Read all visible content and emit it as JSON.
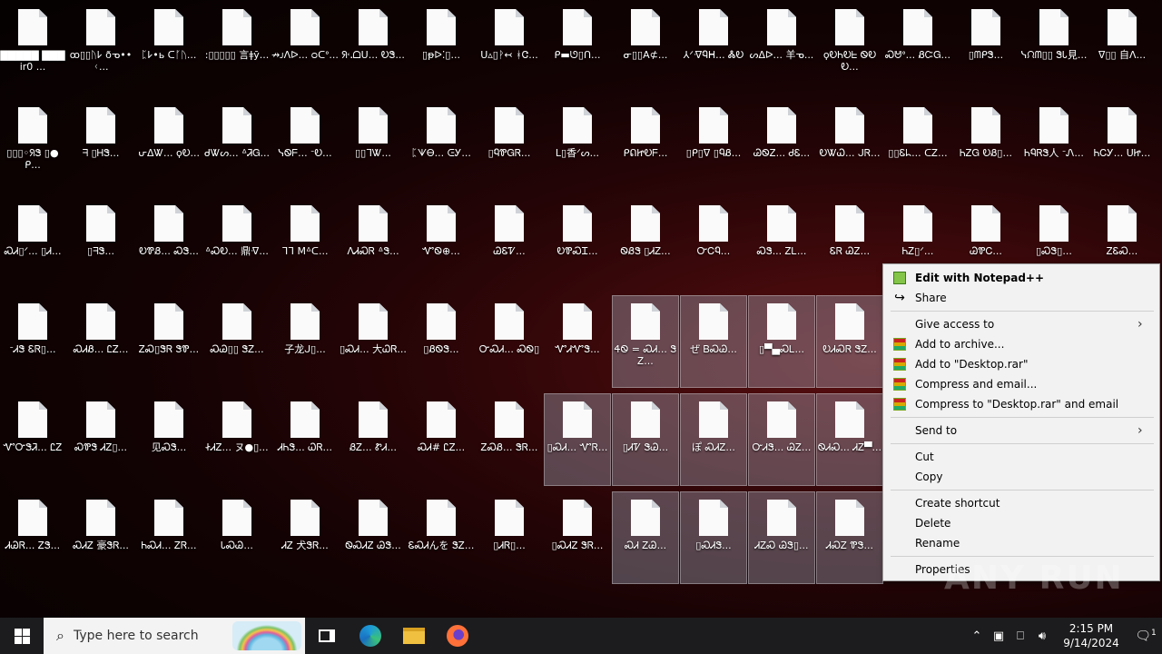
{
  "desktop": {
    "icons": [
      {
        "label": "▇▇▇▇▇ ▇▇▇ ir0 ...",
        "col": 0,
        "row": 0,
        "selected": false
      },
      {
        "label": "ꝏ▯▯ᚢ𐌋 ðᓀ••ᚲ...",
        "col": 1,
        "row": 0,
        "selected": false
      },
      {
        "label": "ᛈ𐌋•ь ᑕᚪᚢ...",
        "col": 2,
        "row": 0,
        "selected": false
      },
      {
        "label": ":▯▯▯▯▯ 言ǂȳ...",
        "col": 3,
        "row": 0,
        "selected": false
      },
      {
        "label": "↛ᴊᐱᐅ... ᴑᑕᐤ...",
        "col": 4,
        "row": 0,
        "selected": false
      },
      {
        "label": "ᖆ˓᎐ᗝᑌ... ᎧᏕ...",
        "col": 5,
        "row": 0,
        "selected": false
      },
      {
        "label": "▯ᵽᐅ⁚▯...",
        "col": 6,
        "row": 0,
        "selected": false
      },
      {
        "label": "ᑌ▵▯ᚹ↢ ᚼᏣ...",
        "col": 7,
        "row": 0,
        "selected": false
      },
      {
        "label": "ᑭ▬ᘎ▯ᑎ...",
        "col": 8,
        "row": 0,
        "selected": false
      },
      {
        "label": "ᓂ▯▯A⊄...",
        "col": 9,
        "row": 0,
        "selected": false
      },
      {
        "label": "⅄ᐟᐌᏄᕼ... ᏜᎧ",
        "col": 10,
        "row": 0,
        "selected": false
      },
      {
        "label": "ᔕᐃᐅ... 羊ᓀ...",
        "col": 11,
        "row": 0,
        "selected": false
      },
      {
        "label": "ϙᎧᏂᎧᖶ ᏫᎧᎧ...",
        "col": 12,
        "row": 0,
        "selected": false
      },
      {
        "label": "Ꮝᕰᐤ... ᏰᏨᏀ...",
        "col": 13,
        "row": 0,
        "selected": false
      },
      {
        "label": "▯ᗰᑭᏕ...",
        "col": 14,
        "row": 0,
        "selected": false
      },
      {
        "label": "ᓭᙁᗰ▯▯ ᏕᏓ見...",
        "col": 15,
        "row": 0,
        "selected": false
      },
      {
        "label": "ᐁ▯▯ 自ᐱ...",
        "col": 16,
        "row": 0,
        "selected": false
      },
      {
        "label": "▯▯▯◦ᖆᏕ ▯●ᑭ...",
        "col": 0,
        "row": 1,
        "selected": false
      },
      {
        "label": "ᖷ ▯ᎻᏕ...",
        "col": 1,
        "row": 1,
        "selected": false
      },
      {
        "label": "ᕂᐃᏔ... ϙᎧ...",
        "col": 2,
        "row": 1,
        "selected": false
      },
      {
        "label": "ᑯᏔᔕ... ᐞᏘᏀ...",
        "col": 3,
        "row": 1,
        "selected": false
      },
      {
        "label": "ᓭᏫᖴ... ᐨᎧ...",
        "col": 4,
        "row": 1,
        "selected": false
      },
      {
        "label": "▯▯ᒣᏔ...",
        "col": 5,
        "row": 1,
        "selected": false
      },
      {
        "label": "ᛈᗐᎾ... ᕮᎩ...",
        "col": 6,
        "row": 1,
        "selected": false
      },
      {
        "label": "▯ᏄᏈᏀᏒ...",
        "col": 7,
        "row": 1,
        "selected": false
      },
      {
        "label": "ᒪ▯香ᐟᔕ...",
        "col": 8,
        "row": 1,
        "selected": false
      },
      {
        "label": "ᑭᕠᏥᎧᖴ...",
        "col": 9,
        "row": 1,
        "selected": false
      },
      {
        "label": "▯ᑭ▯ᐁ ▯ᏄᏰ...",
        "col": 10,
        "row": 1,
        "selected": false
      },
      {
        "label": "ᏊᏫᏃ... ᏧᏋ...",
        "col": 11,
        "row": 1,
        "selected": false
      },
      {
        "label": "ᎧᏔᏇ... ᒍᏒ...",
        "col": 12,
        "row": 1,
        "selected": false
      },
      {
        "label": "▯▯Ꮛᖺ... ᑕᏃ...",
        "col": 13,
        "row": 1,
        "selected": false
      },
      {
        "label": "ᏂᏃᏀ ᎧᏰ▯...",
        "col": 14,
        "row": 1,
        "selected": false
      },
      {
        "label": "ᏂᏄᏒᏕ人 ᐨᏁ...",
        "col": 15,
        "row": 1,
        "selected": false
      },
      {
        "label": "ᏂᏟᎩ... ᑌᏥ...",
        "col": 16,
        "row": 1,
        "selected": false
      },
      {
        "label": "ᏍᏗ▯ᐟ... ▯Ꮧ...",
        "col": 0,
        "row": 2,
        "selected": false
      },
      {
        "label": "▯ᖷᏕ...",
        "col": 1,
        "row": 2,
        "selected": false
      },
      {
        "label": "ᎧᏈᏰ... ᏍᏕ...",
        "col": 2,
        "row": 2,
        "selected": false
      },
      {
        "label": "ᐞᏍᎧ... 鼎ᐌ...",
        "col": 3,
        "row": 2,
        "selected": false
      },
      {
        "label": "ᒣᒣ Mᐞᑕ...",
        "col": 4,
        "row": 2,
        "selected": false
      },
      {
        "label": "ᐱᏗᏍᏒ ᐞᏕ...",
        "col": 5,
        "row": 2,
        "selected": false
      },
      {
        "label": "ᏉᏫ⊕...",
        "col": 6,
        "row": 2,
        "selected": false
      },
      {
        "label": "ᏊᏋᏤ...",
        "col": 7,
        "row": 2,
        "selected": false
      },
      {
        "label": "ᎧᏈᏍᏆ...",
        "col": 8,
        "row": 2,
        "selected": false
      },
      {
        "label": "ᏫᏰᏕ ▯ᏗᏃ...",
        "col": 9,
        "row": 2,
        "selected": false
      },
      {
        "label": "ᏅᏟᏄ...",
        "col": 10,
        "row": 2,
        "selected": false
      },
      {
        "label": "ᏍᏕ... ᏃᏞ...",
        "col": 11,
        "row": 2,
        "selected": false
      },
      {
        "label": "ᏋᏒ ᏊᏃ...",
        "col": 12,
        "row": 2,
        "selected": false
      },
      {
        "label": "ᏂᏃ▯ᐟ...",
        "col": 13,
        "row": 2,
        "selected": false
      },
      {
        "label": "ᏊᏈᏟ...",
        "col": 14,
        "row": 2,
        "selected": false
      },
      {
        "label": "▯ᏍᏕ▯...",
        "col": 15,
        "row": 2,
        "selected": false
      },
      {
        "label": "ᏃᏋᏍ...",
        "col": 16,
        "row": 2,
        "selected": false
      },
      {
        "label": "ᐨᏗᏕ ᏋᏒ▯...",
        "col": 0,
        "row": 3,
        "selected": false
      },
      {
        "label": "ᏍᏗᏰ... ᏝᏃ...",
        "col": 1,
        "row": 3,
        "selected": false
      },
      {
        "label": "ᏃᏍ▯ᏕᏒ ᏕᏈ...",
        "col": 2,
        "row": 3,
        "selected": false
      },
      {
        "label": "ᏍᏊ▯▯ ᏕᏃ...",
        "col": 3,
        "row": 3,
        "selected": false
      },
      {
        "label": "子龙ᒍ▯...",
        "col": 4,
        "row": 3,
        "selected": false
      },
      {
        "label": "▯ᏍᏗ... 大ᏇᏒ...",
        "col": 5,
        "row": 3,
        "selected": false
      },
      {
        "label": "▯ᏰᏫᏕ...",
        "col": 6,
        "row": 3,
        "selected": false
      },
      {
        "label": "ᏅᏍᏗ... ᏍᏫ▯",
        "col": 7,
        "row": 3,
        "selected": false
      },
      {
        "label": "ᏉᏗᏉᏕ...",
        "col": 8,
        "row": 3,
        "selected": false
      },
      {
        "label": "ᏎᏫ = ᏍᏗ... ᏕᏃ...",
        "col": 9,
        "row": 3,
        "selected": true
      },
      {
        "label": "ぜ ᏴᏍᏊ...",
        "col": 10,
        "row": 3,
        "selected": true
      },
      {
        "label": "▯▀▄ᏍᏞ...",
        "col": 11,
        "row": 3,
        "selected": true
      },
      {
        "label": "ᎧᏗᏍᏒ ᏕᏃ...",
        "col": 12,
        "row": 3,
        "selected": true
      },
      {
        "label": "ᏉᏅᏕᏘ... ᏝᏃ",
        "col": 0,
        "row": 4,
        "selected": false
      },
      {
        "label": "ᏍᏈᏕ ᏗᏃ▯...",
        "col": 1,
        "row": 4,
        "selected": false
      },
      {
        "label": "见ᏍᏕ...",
        "col": 2,
        "row": 4,
        "selected": false
      },
      {
        "label": "ᏐᏗᏃ... ヌ●▯...",
        "col": 3,
        "row": 4,
        "selected": false
      },
      {
        "label": "ᏗᏂᏕ... ᏇᏒ...",
        "col": 4,
        "row": 4,
        "selected": false
      },
      {
        "label": "ᏰᏃ... ᏑᏗ...",
        "col": 5,
        "row": 4,
        "selected": false
      },
      {
        "label": "ᏍᏗ# ᏝᏃ...",
        "col": 6,
        "row": 4,
        "selected": false
      },
      {
        "label": "ᏃᏍᏰ... ᏕᏒ...",
        "col": 7,
        "row": 4,
        "selected": false
      },
      {
        "label": "▯ᏍᏗ... ᏉᏒ...",
        "col": 8,
        "row": 4,
        "selected": true
      },
      {
        "label": "▯ᏗᏤ ᏕᏊ...",
        "col": 9,
        "row": 4,
        "selected": true
      },
      {
        "label": "ぽ ᏍᏗᏃ...",
        "col": 10,
        "row": 4,
        "selected": true
      },
      {
        "label": "ᏅᏗᏕ... ᏊᏃ...",
        "col": 11,
        "row": 4,
        "selected": true
      },
      {
        "label": "ᏫᏗᏍ... ᏗᏃ▀...",
        "col": 12,
        "row": 4,
        "selected": true
      },
      {
        "label": "ᏗᏊᏒ... ᏃᏕ...",
        "col": 0,
        "row": 5,
        "selected": false
      },
      {
        "label": "ᏍᏗᏃ 豪ᏕᏒ...",
        "col": 1,
        "row": 5,
        "selected": false
      },
      {
        "label": "ᏂᏍᏗ... ᏃᏒ...",
        "col": 2,
        "row": 5,
        "selected": false
      },
      {
        "label": "ᏓᏍᏊ...",
        "col": 3,
        "row": 5,
        "selected": false
      },
      {
        "label": "ᏗᏃ 犬ᏕᏒ...",
        "col": 4,
        "row": 5,
        "selected": false
      },
      {
        "label": "ᏫᏍᏗᏃ ᏊᏕ...",
        "col": 5,
        "row": 5,
        "selected": false
      },
      {
        "label": "ᏋᏍᏗんを ᏕᏃ...",
        "col": 6,
        "row": 5,
        "selected": false
      },
      {
        "label": "▯ᏗᏒ▯...",
        "col": 7,
        "row": 5,
        "selected": false
      },
      {
        "label": "▯ᏍᏗᏃ ᏕᏒ...",
        "col": 8,
        "row": 5,
        "selected": false
      },
      {
        "label": "ᏍᏗ ᏃᏊ...",
        "col": 9,
        "row": 5,
        "selected": true
      },
      {
        "label": "▯ᏍᏗᏕ...",
        "col": 10,
        "row": 5,
        "selected": true
      },
      {
        "label": "ᏗᏃᏍ ᏊᏕ▯...",
        "col": 11,
        "row": 5,
        "selected": true
      },
      {
        "label": "ᏗᏍᏃ ᏈᏕ...",
        "col": 12,
        "row": 5,
        "selected": true
      }
    ]
  },
  "context_menu": {
    "items": [
      {
        "type": "item",
        "label": "Edit with Notepad++",
        "icon": "notepadpp-icon",
        "bold": true,
        "submenu": false
      },
      {
        "type": "item",
        "label": "Share",
        "icon": "share-icon",
        "bold": false,
        "submenu": false
      },
      {
        "type": "separator"
      },
      {
        "type": "item",
        "label": "Give access to",
        "icon": "",
        "bold": false,
        "submenu": true
      },
      {
        "type": "item",
        "label": "Add to archive...",
        "icon": "winrar-icon",
        "bold": false,
        "submenu": false
      },
      {
        "type": "item",
        "label": "Add to \"Desktop.rar\"",
        "icon": "winrar-icon",
        "bold": false,
        "submenu": false
      },
      {
        "type": "item",
        "label": "Compress and email...",
        "icon": "winrar-icon",
        "bold": false,
        "submenu": false
      },
      {
        "type": "item",
        "label": "Compress to \"Desktop.rar\" and email",
        "icon": "winrar-icon",
        "bold": false,
        "submenu": false
      },
      {
        "type": "separator"
      },
      {
        "type": "item",
        "label": "Send to",
        "icon": "",
        "bold": false,
        "submenu": true
      },
      {
        "type": "separator"
      },
      {
        "type": "item",
        "label": "Cut",
        "icon": "",
        "bold": false,
        "submenu": false
      },
      {
        "type": "item",
        "label": "Copy",
        "icon": "",
        "bold": false,
        "submenu": false
      },
      {
        "type": "separator"
      },
      {
        "type": "item",
        "label": "Create shortcut",
        "icon": "",
        "bold": false,
        "submenu": false
      },
      {
        "type": "item",
        "label": "Delete",
        "icon": "",
        "bold": false,
        "submenu": false
      },
      {
        "type": "item",
        "label": "Rename",
        "icon": "",
        "bold": false,
        "submenu": false
      },
      {
        "type": "separator"
      },
      {
        "type": "item",
        "label": "Properties",
        "icon": "",
        "bold": false,
        "submenu": false
      }
    ]
  },
  "taskbar": {
    "search_placeholder": "Type here to search",
    "pinned": [
      "task-view-icon",
      "edge-icon",
      "file-explorer-icon",
      "firefox-icon"
    ],
    "tray": {
      "time": "2:15 PM",
      "date": "9/14/2024",
      "notifications": "1"
    }
  },
  "watermark": "ANY RUN"
}
